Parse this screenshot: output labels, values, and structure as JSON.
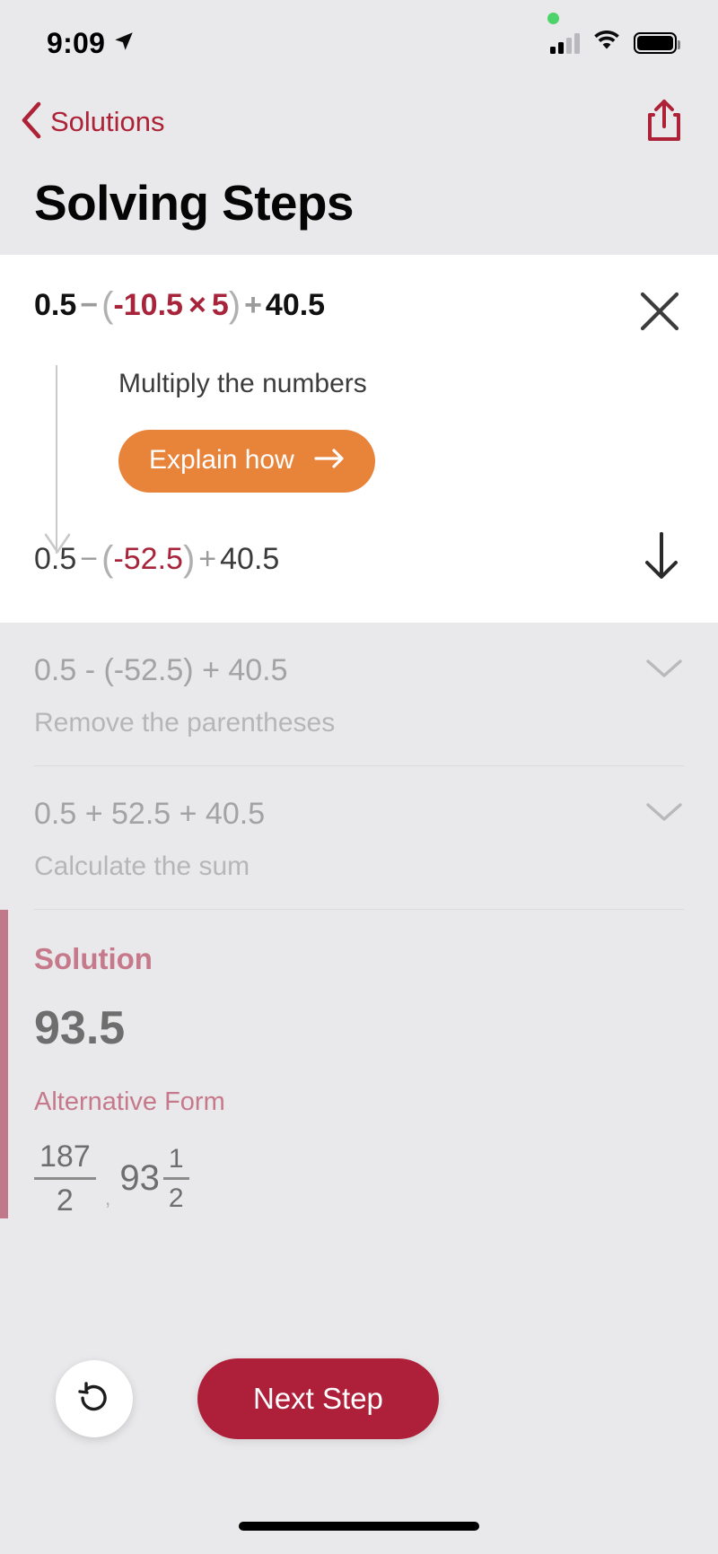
{
  "status_bar": {
    "time": "9:09",
    "location_icon": "location-arrow-icon",
    "signal_icon": "cellular-signal-icon",
    "wifi_icon": "wifi-icon",
    "battery_icon": "battery-icon",
    "recording_dot": "green-status-dot"
  },
  "nav": {
    "back_label": "Solutions",
    "back_icon": "chevron-left-icon",
    "share_icon": "share-icon"
  },
  "header": {
    "title": "Solving Steps"
  },
  "active_step": {
    "expression": {
      "parts": [
        {
          "t": "0.5",
          "c": "b"
        },
        {
          "t": "−",
          "c": "op"
        },
        {
          "t": "(",
          "c": "par"
        },
        {
          "t": "-10.5",
          "c": "hl"
        },
        {
          "t": "×",
          "c": "hl"
        },
        {
          "t": "5",
          "c": "hl"
        },
        {
          "t": ")",
          "c": "par"
        },
        {
          "t": "+",
          "c": "op"
        },
        {
          "t": "40.5",
          "c": "b"
        }
      ],
      "plain": "0.5 - (-10.5 × 5) + 40.5"
    },
    "close_icon": "close-x-icon",
    "instruction": "Multiply the numbers",
    "explain_button": "Explain how",
    "explain_arrow_icon": "arrow-right-icon",
    "flow_arrow_icon": "arrow-down-long-icon",
    "result": {
      "plain": "0.5 - (-52.5) + 40.5",
      "parts": [
        {
          "t": "0.5",
          "c": "n"
        },
        {
          "t": "−",
          "c": "opl"
        },
        {
          "t": "(",
          "c": "par"
        },
        {
          "t": "-52.5",
          "c": "hl2"
        },
        {
          "t": ")",
          "c": "par"
        },
        {
          "t": "+",
          "c": "opl"
        },
        {
          "t": "40.5",
          "c": "n"
        }
      ]
    },
    "result_arrow_icon": "arrow-down-icon"
  },
  "upcoming_steps": [
    {
      "expression": "0.5 - (-52.5) + 40.5",
      "description": "Remove the parentheses",
      "chevron_icon": "chevron-down-icon"
    },
    {
      "expression": "0.5 + 52.5 + 40.5",
      "description": "Calculate the sum",
      "chevron_icon": "chevron-down-icon"
    }
  ],
  "solution": {
    "title": "Solution",
    "value": "93.5",
    "alt_label": "Alternative Form",
    "alt_fraction": {
      "numerator": "187",
      "denominator": "2"
    },
    "alt_separator": ",",
    "alt_mixed": {
      "whole": "93",
      "numerator": "1",
      "denominator": "2"
    }
  },
  "actions": {
    "undo_icon": "undo-icon",
    "next_label": "Next Step"
  },
  "colors": {
    "brand_red": "#ae2039",
    "accent_orange": "#e8833a",
    "highlight_red": "#a7243a",
    "solution_rose": "#c6798b",
    "page_bg": "#e9e9eb",
    "card_bg": "#ffffff"
  }
}
